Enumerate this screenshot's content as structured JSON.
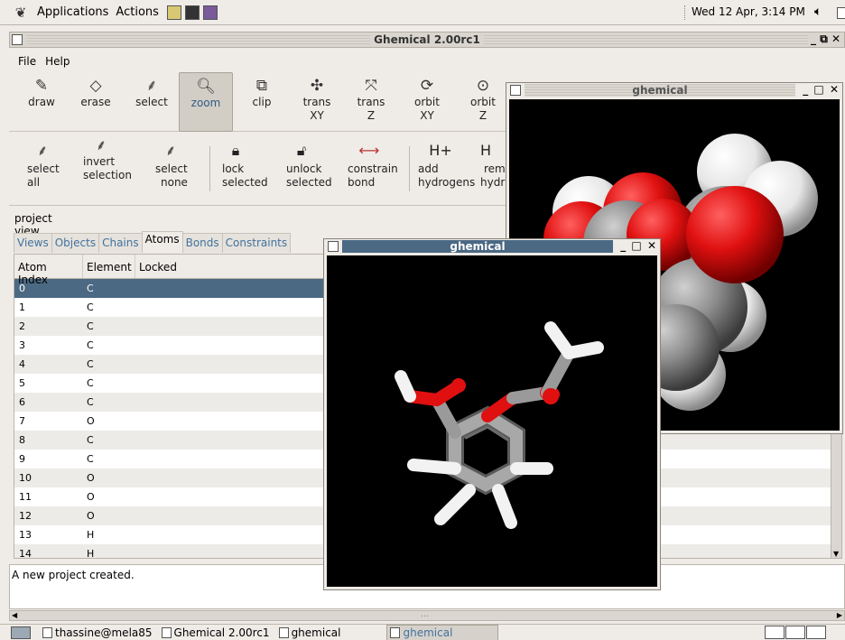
{
  "top_panel": {
    "menus": [
      "Applications",
      "Actions"
    ],
    "clock": "Wed 12 Apr,  3:14 PM"
  },
  "main_window": {
    "title": "Ghemical 2.00rc1",
    "controls": "_ ⧉ ✕",
    "menu": {
      "file": "File",
      "help": "Help"
    },
    "toolbar1": [
      {
        "icon": "pencil-icon",
        "glyph": "✎",
        "label": "draw",
        "label2": ""
      },
      {
        "icon": "eraser-icon",
        "glyph": "◇",
        "label": "erase",
        "label2": ""
      },
      {
        "icon": "select-icon",
        "glyph": "⸙",
        "label": "select",
        "label2": ""
      },
      {
        "icon": "magnifier-icon",
        "glyph": "🔍︎",
        "label": "zoom",
        "label2": ""
      },
      {
        "icon": "clip-icon",
        "glyph": "⧉",
        "label": "clip",
        "label2": ""
      },
      {
        "icon": "translate-xy-icon",
        "glyph": "✣",
        "label": "trans",
        "label2": "XY"
      },
      {
        "icon": "translate-z-icon",
        "glyph": "⤧",
        "label": "trans",
        "label2": "Z"
      },
      {
        "icon": "orbit-xy-icon",
        "glyph": "⟳",
        "label": "orbit",
        "label2": "XY"
      },
      {
        "icon": "orbit-z-icon",
        "glyph": "⊙",
        "label": "orbit",
        "label2": "Z"
      }
    ],
    "toolbar2": [
      {
        "icon": "select-all-icon",
        "glyph": "⸙",
        "line1": "select",
        "line2": "all",
        "pre": ""
      },
      {
        "icon": "invert-selection-icon",
        "glyph": "⸙",
        "line1": "selection",
        "line2": "",
        "pre": "invert"
      },
      {
        "icon": "select-none-icon",
        "glyph": "⸙",
        "line1": "select",
        "line2": "none",
        "pre": ""
      },
      {
        "icon": "lock-icon",
        "glyph": "🔒︎",
        "line1": "lock",
        "line2": "selected",
        "pre": ""
      },
      {
        "icon": "unlock-icon",
        "glyph": "🔓︎",
        "line1": "unlock",
        "line2": "selected",
        "pre": ""
      },
      {
        "icon": "constrain-bond-icon",
        "glyph": "⟷",
        "line1": "constrain",
        "line2": "bond",
        "pre": ""
      },
      {
        "icon": "add-hydrogens-icon",
        "glyph": "H+",
        "line1": "add",
        "line2": "hydrogens",
        "pre": ""
      },
      {
        "icon": "remove-hydrogens-icon",
        "glyph": "H",
        "line1": "rem",
        "line2": "hydr",
        "pre": ""
      }
    ],
    "project_view": "project view",
    "tabs": [
      "Views",
      "Objects",
      "Chains",
      "Atoms",
      "Bonds",
      "Constraints"
    ],
    "active_tab": "Atoms",
    "table": {
      "columns": [
        "Atom Index",
        "Element",
        "Locked"
      ],
      "rows": [
        [
          "0",
          "C"
        ],
        [
          "1",
          "C"
        ],
        [
          "2",
          "C"
        ],
        [
          "3",
          "C"
        ],
        [
          "4",
          "C"
        ],
        [
          "5",
          "C"
        ],
        [
          "6",
          "C"
        ],
        [
          "7",
          "O"
        ],
        [
          "8",
          "C"
        ],
        [
          "9",
          "C"
        ],
        [
          "10",
          "O"
        ],
        [
          "11",
          "O"
        ],
        [
          "12",
          "O"
        ],
        [
          "13",
          "H"
        ],
        [
          "14",
          "H"
        ]
      ]
    },
    "status_message": "A new project created.",
    "hscroll_mark": "..."
  },
  "ghemical_window_back": {
    "title": "ghemical",
    "controls": "_ □ ✕"
  },
  "ghemical_window_front": {
    "title": "ghemical",
    "controls": "_ □ ✕"
  },
  "taskbar": {
    "tasks": [
      "thassine@mela85",
      "Ghemical 2.00rc1",
      "ghemical",
      "ghemical"
    ],
    "active_index": 3
  },
  "colors": {
    "selection": "#4b6983",
    "oxygen": "#e01010",
    "carbon": "#8c8c8c",
    "hydrogen": "#ffffff",
    "link_tab": "#41729f"
  }
}
